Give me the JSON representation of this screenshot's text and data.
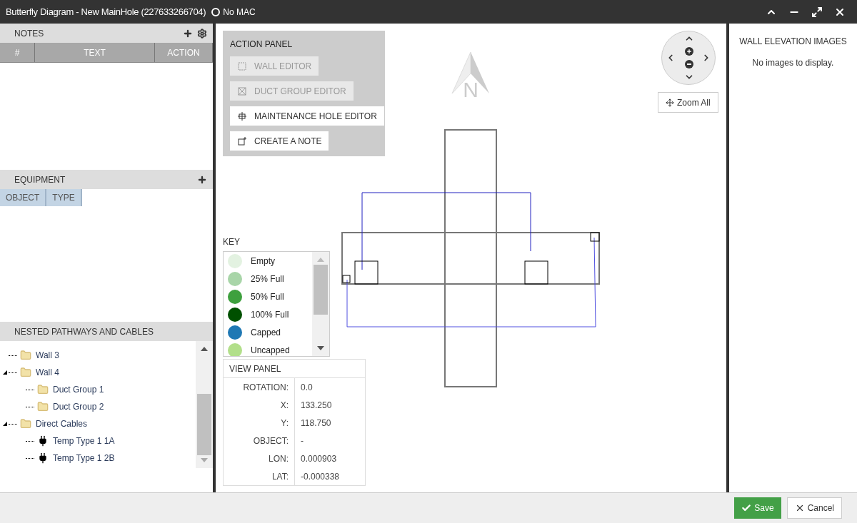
{
  "window": {
    "title": "Butterfly Diagram - New MainHole (227633266704)",
    "status": "No MAC"
  },
  "notes": {
    "title": "NOTES",
    "columns": [
      "#",
      "TEXT",
      "ACTION"
    ]
  },
  "equipment": {
    "title": "EQUIPMENT",
    "columns": [
      "OBJECT",
      "TYPE"
    ]
  },
  "tree": {
    "title": "NESTED PATHWAYS AND CABLES",
    "items": [
      {
        "label": "Wall 3",
        "kind": "folder"
      },
      {
        "label": "Wall 4",
        "kind": "folder",
        "expanded": true,
        "children": [
          {
            "label": "Duct Group 1",
            "kind": "folder"
          },
          {
            "label": "Duct Group 2",
            "kind": "folder"
          }
        ]
      },
      {
        "label": "Direct Cables",
        "kind": "folder",
        "expanded": true,
        "children": [
          {
            "label": "Temp Type 1 1A",
            "kind": "cable"
          },
          {
            "label": "Temp Type 1 2B",
            "kind": "cable"
          }
        ]
      }
    ]
  },
  "action_panel": {
    "title": "ACTION PANEL",
    "buttons": [
      {
        "label": "WALL EDITOR",
        "kind": "wall",
        "disabled": true
      },
      {
        "label": "DUCT GROUP EDITOR",
        "kind": "duct",
        "disabled": true
      },
      {
        "label": "MAINTENANCE HOLE EDITOR",
        "kind": "hole",
        "disabled": false
      },
      {
        "label": "CREATE A NOTE",
        "kind": "note",
        "disabled": false
      }
    ]
  },
  "compass": {
    "label": "N"
  },
  "zoom_all": "Zoom All",
  "key": {
    "title": "KEY",
    "items": [
      {
        "label": "Empty",
        "color": "#e3f2e1"
      },
      {
        "label": "25% Full",
        "color": "#a8d5a8"
      },
      {
        "label": "50% Full",
        "color": "#3ea03e"
      },
      {
        "label": "100% Full",
        "color": "#005000"
      },
      {
        "label": "Capped",
        "color": "#1f78b4"
      },
      {
        "label": "Uncapped",
        "color": "#b2df8a"
      }
    ]
  },
  "view_panel": {
    "title": "VIEW PANEL",
    "rows": [
      {
        "label": "ROTATION:",
        "value": "0.0"
      },
      {
        "label": "X:",
        "value": "133.250"
      },
      {
        "label": "Y:",
        "value": "118.750"
      },
      {
        "label": "OBJECT:",
        "value": "-"
      },
      {
        "label": "LON:",
        "value": "0.000903"
      },
      {
        "label": "LAT:",
        "value": "-0.000338"
      }
    ]
  },
  "wall_images": {
    "title": "WALL ELEVATION IMAGES",
    "empty": "No images to display."
  },
  "footer": {
    "save": "Save",
    "cancel": "Cancel"
  }
}
